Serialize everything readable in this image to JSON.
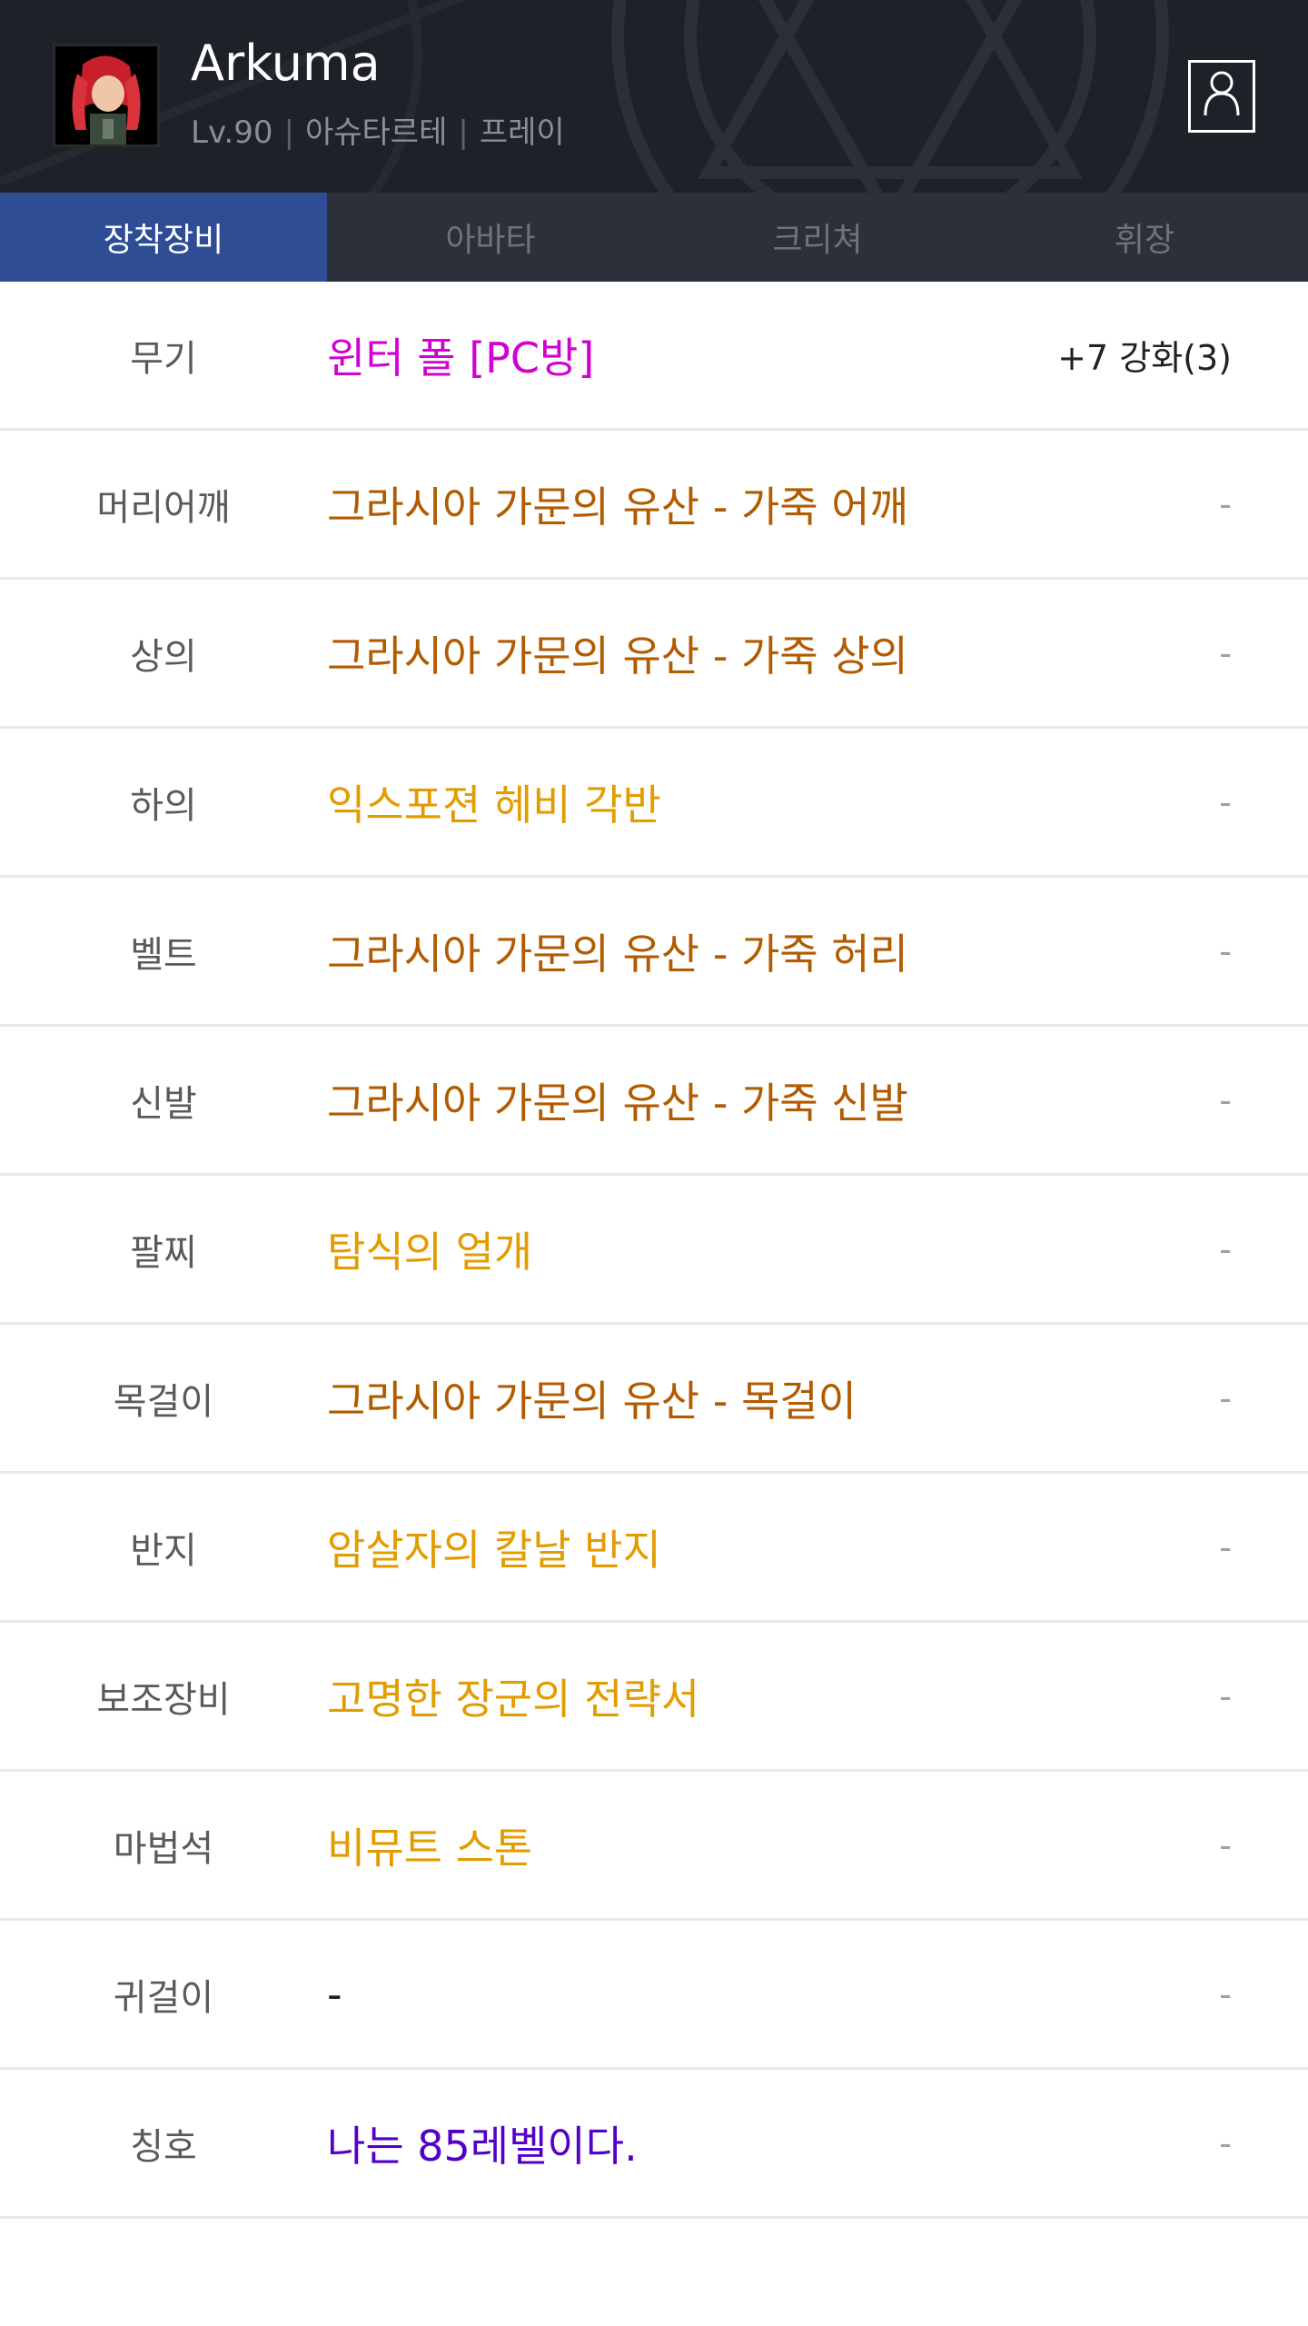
{
  "colors": {
    "header_bg": "#1e2128",
    "tab_bar_bg": "#2b303b",
    "tab_active_bg": "#2f4d95",
    "epic": "#d200d2",
    "unique": "#b25b00",
    "legendary": "#e39c00",
    "common": "#222222",
    "title": "#5300c8"
  },
  "character": {
    "name": "Arkuma",
    "level": "Lv.90",
    "adventure": "아슈타르테",
    "server": "프레이",
    "avatar_icon": "character-portrait-icon",
    "profile_icon": "person-icon"
  },
  "tabs": [
    {
      "label": "장착장비",
      "active": true
    },
    {
      "label": "아바타",
      "active": false
    },
    {
      "label": "크리쳐",
      "active": false
    },
    {
      "label": "휘장",
      "active": false
    }
  ],
  "equipment": [
    {
      "slot": "무기",
      "item": "윈터 폴 [PC방]",
      "color": "#d200d2",
      "extra": "+7 강화(3)"
    },
    {
      "slot": "머리어깨",
      "item": "그라시아 가문의 유산 - 가죽 어깨",
      "color": "#b25b00",
      "extra": "-"
    },
    {
      "slot": "상의",
      "item": "그라시아 가문의 유산 - 가죽 상의",
      "color": "#b25b00",
      "extra": "-"
    },
    {
      "slot": "하의",
      "item": "익스포젼 헤비 각반",
      "color": "#e39c00",
      "extra": "-"
    },
    {
      "slot": "벨트",
      "item": "그라시아 가문의 유산 - 가죽 허리",
      "color": "#b25b00",
      "extra": "-"
    },
    {
      "slot": "신발",
      "item": "그라시아 가문의 유산 - 가죽 신발",
      "color": "#b25b00",
      "extra": "-"
    },
    {
      "slot": "팔찌",
      "item": "탐식의 얼개",
      "color": "#e39c00",
      "extra": "-"
    },
    {
      "slot": "목걸이",
      "item": "그라시아 가문의 유산 - 목걸이",
      "color": "#b25b00",
      "extra": "-"
    },
    {
      "slot": "반지",
      "item": "암살자의 칼날 반지",
      "color": "#e39c00",
      "extra": "-"
    },
    {
      "slot": "보조장비",
      "item": "고명한 장군의 전략서",
      "color": "#e39c00",
      "extra": "-"
    },
    {
      "slot": "마법석",
      "item": "비뮤트 스톤",
      "color": "#e39c00",
      "extra": "-"
    },
    {
      "slot": "귀걸이",
      "item": "-",
      "color": "#222222",
      "extra": "-"
    },
    {
      "slot": "칭호",
      "item": "나는 85레벨이다.",
      "color": "#5300c8",
      "extra": "-"
    }
  ]
}
